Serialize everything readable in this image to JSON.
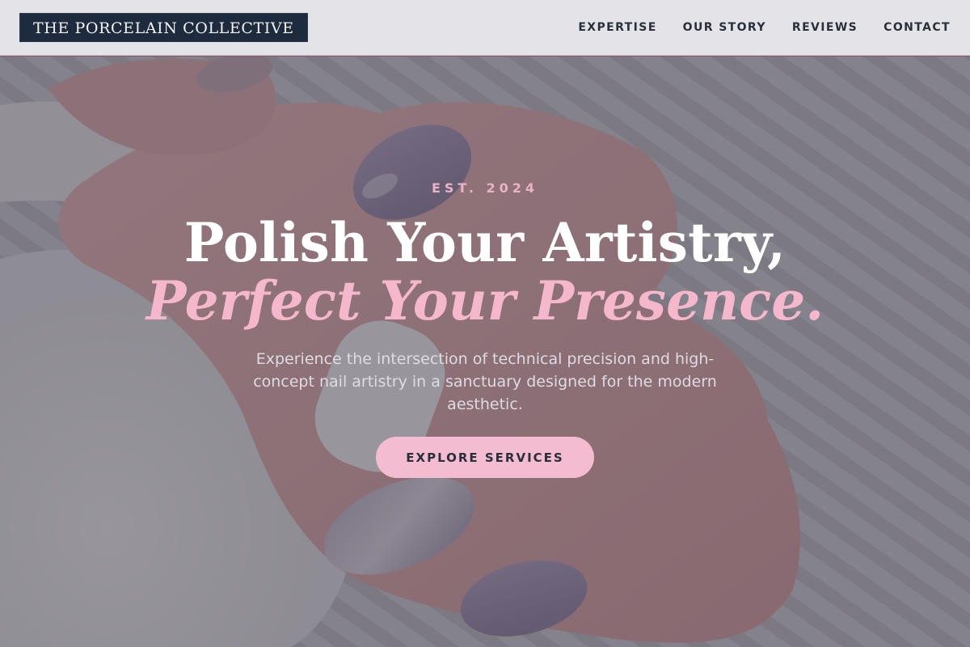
{
  "header": {
    "brand": "THE PORCELAIN COLLECTIVE",
    "nav": [
      "EXPERTISE",
      "OUR STORY",
      "REVIEWS",
      "CONTACT"
    ]
  },
  "hero": {
    "eyebrow": "EST. 2024",
    "headline_line1": "Polish Your Artistry,",
    "headline_line2": "Perfect Your Presence.",
    "description": "Experience the intersection of technical precision and high-concept nail artistry in a sanctuary designed for the modern aesthetic.",
    "cta_label": "EXPLORE SERVICES",
    "background_image": "manicured-hand-on-knit-sweater-photo"
  },
  "colors": {
    "brand_navy": "#1e2a3e",
    "accent_pink": "#f4bcd1",
    "header_bg": "#e4e4e8"
  }
}
